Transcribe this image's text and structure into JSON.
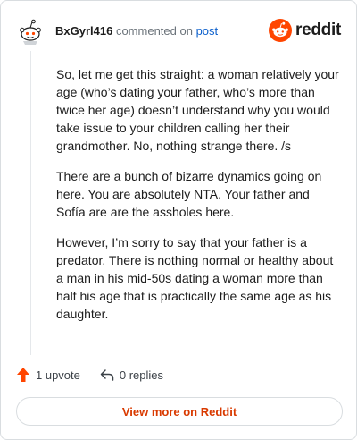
{
  "header": {
    "username": "BxGyrl416",
    "commented_on_text": "commented on",
    "post_link_text": "post",
    "logo_text": "reddit"
  },
  "comment": {
    "paragraphs": [
      "So, let me get this straight: a woman relatively your age (who’s dating your father, who’s more than twice her age) doesn’t understand why you would take issue to your children calling her their grandmother. No, nothing strange there. /s",
      "There are a bunch of bizarre dynamics going on here. You are absolutely NTA. Your father and Sofía are are the assholes here.",
      "However, I’m sorry to say that your father is a predator. There is nothing normal or healthy about a man in his mid-50s dating a woman more than half his age that is practically the same age as his daughter."
    ]
  },
  "actions": {
    "upvote_label": "1 upvote",
    "replies_label": "0 replies"
  },
  "view_more_label": "View more on Reddit",
  "colors": {
    "brand": "#ff4500",
    "link": "#0b5fcc",
    "view_more_text": "#d93a00"
  },
  "icons": {
    "avatar": "snoo-avatar-icon",
    "logo": "reddit-snoo-icon",
    "upvote": "upvote-arrow-icon",
    "reply": "reply-arrow-icon"
  }
}
